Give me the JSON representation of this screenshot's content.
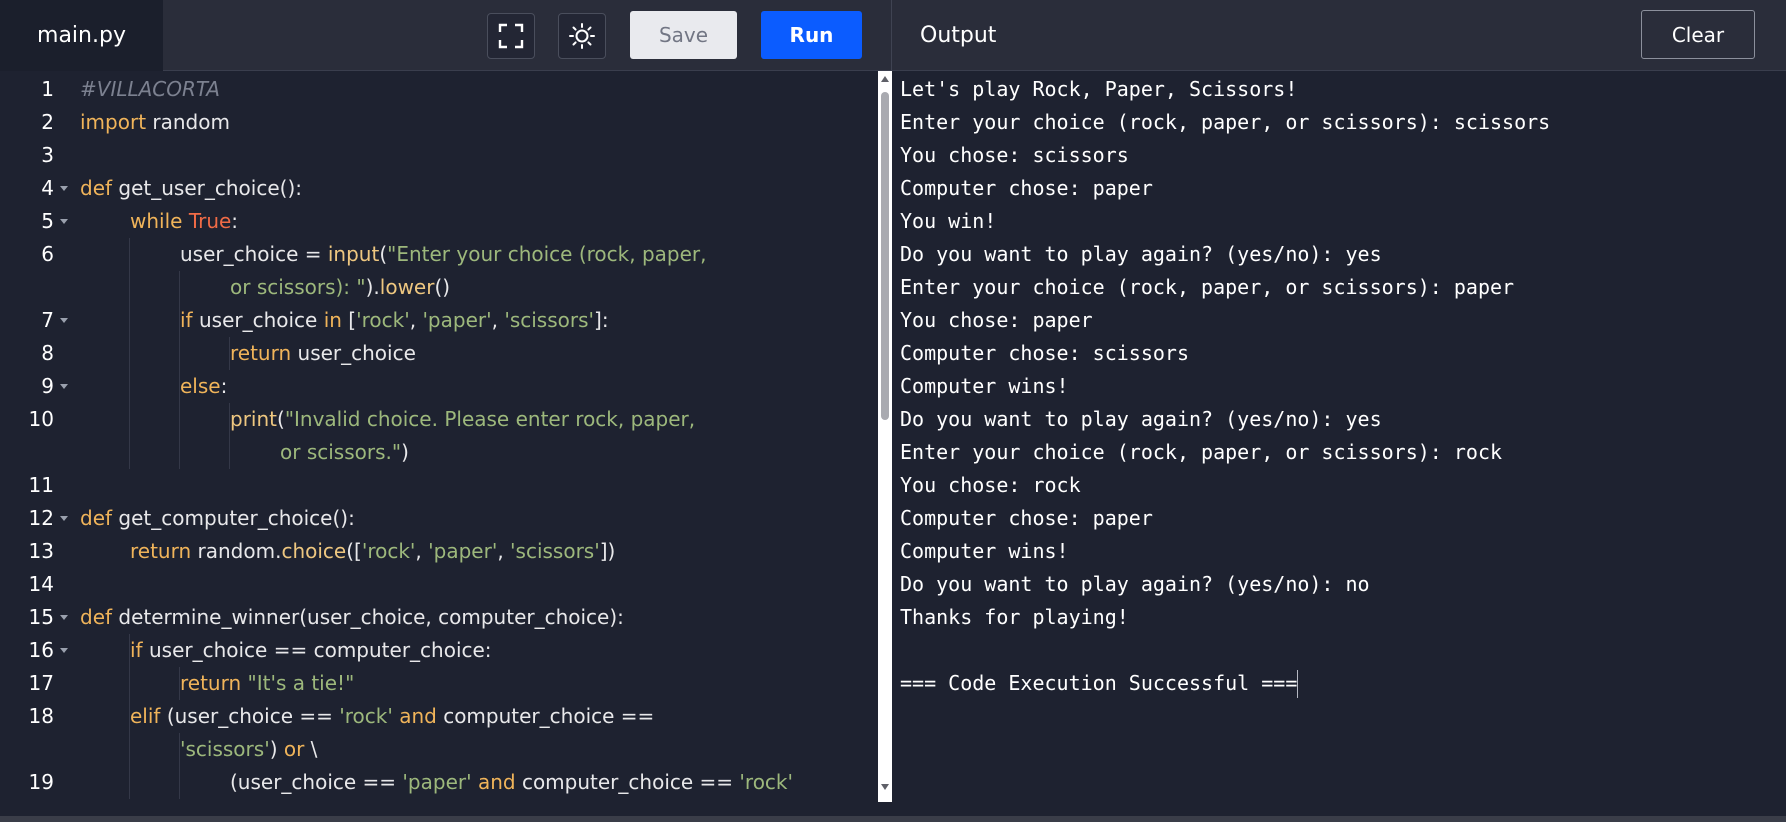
{
  "header": {
    "file_tab": "main.py",
    "save_label": "Save",
    "run_label": "Run",
    "output_title": "Output",
    "clear_label": "Clear",
    "icons": [
      "fullscreen-icon",
      "theme-toggle-icon"
    ]
  },
  "colors": {
    "run_button": "#0b5cff",
    "keyword": "#f0b45a",
    "string": "#9db87c",
    "boolean": "#f06b46",
    "comment": "#7c8190",
    "background": "#1e2230"
  },
  "editor": {
    "lines": [
      {
        "num": "1",
        "t": [
          {
            "c": "cm",
            "s": "#VILLACORTA"
          }
        ]
      },
      {
        "num": "2",
        "t": [
          {
            "c": "kw",
            "s": "import"
          },
          {
            "c": "op",
            "s": " random"
          }
        ]
      },
      {
        "num": "3",
        "t": []
      },
      {
        "num": "4",
        "t": [
          {
            "c": "kw",
            "s": "def"
          },
          {
            "c": "op",
            "s": " get_user_choice():"
          }
        ]
      },
      {
        "num": "5",
        "t": [
          {
            "c": "kw",
            "s": "while"
          },
          {
            "c": "op",
            "s": " "
          },
          {
            "c": "bo",
            "s": "True"
          },
          {
            "c": "op",
            "s": ":"
          }
        ]
      },
      {
        "num": "6",
        "t": [
          {
            "c": "op",
            "s": "user_choice = "
          },
          {
            "c": "fn",
            "s": "input"
          },
          {
            "c": "op",
            "s": "("
          },
          {
            "c": "st",
            "s": "\"Enter your choice (rock, paper,"
          }
        ]
      },
      {
        "num": "",
        "t": [
          {
            "c": "st",
            "s": "or scissors): \""
          },
          {
            "c": "op",
            "s": ")."
          },
          {
            "c": "fn",
            "s": "lower"
          },
          {
            "c": "op",
            "s": "()"
          }
        ]
      },
      {
        "num": "7",
        "t": [
          {
            "c": "kw",
            "s": "if"
          },
          {
            "c": "op",
            "s": " user_choice "
          },
          {
            "c": "kw",
            "s": "in"
          },
          {
            "c": "op",
            "s": " ["
          },
          {
            "c": "st",
            "s": "'rock'"
          },
          {
            "c": "op",
            "s": ", "
          },
          {
            "c": "st",
            "s": "'paper'"
          },
          {
            "c": "op",
            "s": ", "
          },
          {
            "c": "st",
            "s": "'scissors'"
          },
          {
            "c": "op",
            "s": "]:"
          }
        ]
      },
      {
        "num": "8",
        "t": [
          {
            "c": "kw",
            "s": "return"
          },
          {
            "c": "op",
            "s": " user_choice"
          }
        ]
      },
      {
        "num": "9",
        "t": [
          {
            "c": "kw",
            "s": "else"
          },
          {
            "c": "op",
            "s": ":"
          }
        ]
      },
      {
        "num": "10",
        "t": [
          {
            "c": "fn",
            "s": "print"
          },
          {
            "c": "op",
            "s": "("
          },
          {
            "c": "st",
            "s": "\"Invalid choice. Please enter rock, paper,"
          }
        ]
      },
      {
        "num": "",
        "t": [
          {
            "c": "st",
            "s": "or scissors.\""
          },
          {
            "c": "op",
            "s": ")"
          }
        ]
      },
      {
        "num": "11",
        "t": []
      },
      {
        "num": "12",
        "t": [
          {
            "c": "kw",
            "s": "def"
          },
          {
            "c": "op",
            "s": " get_computer_choice():"
          }
        ]
      },
      {
        "num": "13",
        "t": [
          {
            "c": "kw",
            "s": "return"
          },
          {
            "c": "op",
            "s": " random."
          },
          {
            "c": "fn",
            "s": "choice"
          },
          {
            "c": "op",
            "s": "(["
          },
          {
            "c": "st",
            "s": "'rock'"
          },
          {
            "c": "op",
            "s": ", "
          },
          {
            "c": "st",
            "s": "'paper'"
          },
          {
            "c": "op",
            "s": ", "
          },
          {
            "c": "st",
            "s": "'scissors'"
          },
          {
            "c": "op",
            "s": "])"
          }
        ]
      },
      {
        "num": "14",
        "t": []
      },
      {
        "num": "15",
        "t": [
          {
            "c": "kw",
            "s": "def"
          },
          {
            "c": "op",
            "s": " determine_winner(user_choice, computer_choice):"
          }
        ]
      },
      {
        "num": "16",
        "t": [
          {
            "c": "kw",
            "s": "if"
          },
          {
            "c": "op",
            "s": " user_choice == computer_choice:"
          }
        ]
      },
      {
        "num": "17",
        "t": [
          {
            "c": "kw",
            "s": "return"
          },
          {
            "c": "op",
            "s": " "
          },
          {
            "c": "st",
            "s": "\"It's a tie!\""
          }
        ]
      },
      {
        "num": "18",
        "t": [
          {
            "c": "kw",
            "s": "elif"
          },
          {
            "c": "op",
            "s": " (user_choice == "
          },
          {
            "c": "st",
            "s": "'rock'"
          },
          {
            "c": "op",
            "s": " "
          },
          {
            "c": "kw",
            "s": "and"
          },
          {
            "c": "op",
            "s": " computer_choice =="
          }
        ]
      },
      {
        "num": "",
        "t": [
          {
            "c": "st",
            "s": "'scissors'"
          },
          {
            "c": "op",
            "s": ") "
          },
          {
            "c": "kw",
            "s": "or"
          },
          {
            "c": "op",
            "s": " \\"
          }
        ]
      },
      {
        "num": "19",
        "t": [
          {
            "c": "op",
            "s": "(user_choice == "
          },
          {
            "c": "st",
            "s": "'paper'"
          },
          {
            "c": "op",
            "s": " "
          },
          {
            "c": "kw",
            "s": "and"
          },
          {
            "c": "op",
            "s": " computer_choice == "
          },
          {
            "c": "st",
            "s": "'rock'"
          }
        ]
      }
    ]
  },
  "output": {
    "lines": [
      "Let's play Rock, Paper, Scissors!",
      "Enter your choice (rock, paper, or scissors): scissors",
      "You chose: scissors",
      "Computer chose: paper",
      "You win!",
      "Do you want to play again? (yes/no): yes",
      "Enter your choice (rock, paper, or scissors): paper",
      "You chose: paper",
      "Computer chose: scissors",
      "Computer wins!",
      "Do you want to play again? (yes/no): yes",
      "Enter your choice (rock, paper, or scissors): rock",
      "You chose: rock",
      "Computer chose: paper",
      "Computer wins!",
      "Do you want to play again? (yes/no): no",
      "Thanks for playing!",
      "",
      "=== Code Execution Successful ==="
    ]
  }
}
